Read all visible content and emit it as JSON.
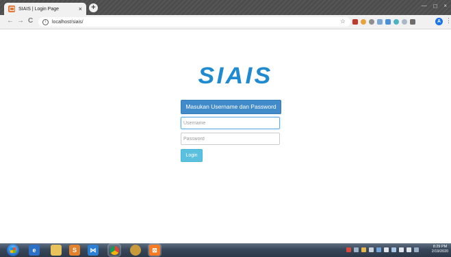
{
  "browser": {
    "tab_title": "SIAIS | Login Page",
    "tab_close": "×",
    "new_tab": "+",
    "window_controls": [
      "—",
      "◻",
      "×"
    ],
    "url": "localhost/siais/",
    "back": "←",
    "forward": "→",
    "reload": "C",
    "info": "i",
    "bookmark_star": "☆",
    "profile_initial": "A",
    "menu": "⋮"
  },
  "page": {
    "logo_text": "SIAIS",
    "heading_label": "Masukan Username dan Password",
    "username_placeholder": "Username",
    "password_placeholder": "Password",
    "login_label": "Login"
  },
  "taskbar": {
    "time": "8:29 PM",
    "date": "2/19/2020"
  },
  "icons": {
    "tab_favicon": "xampp-icon",
    "extensions": [
      "extension-icon"
    ],
    "taskbar_apps": [
      "explorer-icon",
      "ie-icon",
      "files-icon",
      "sublime-icon",
      "vscode-icon",
      "chrome-icon",
      "paint-icon",
      "xampp-icon"
    ]
  },
  "colors": {
    "primary_button": "#428bca",
    "login_button": "#5bc0de",
    "logo": "#1f8ad0"
  }
}
